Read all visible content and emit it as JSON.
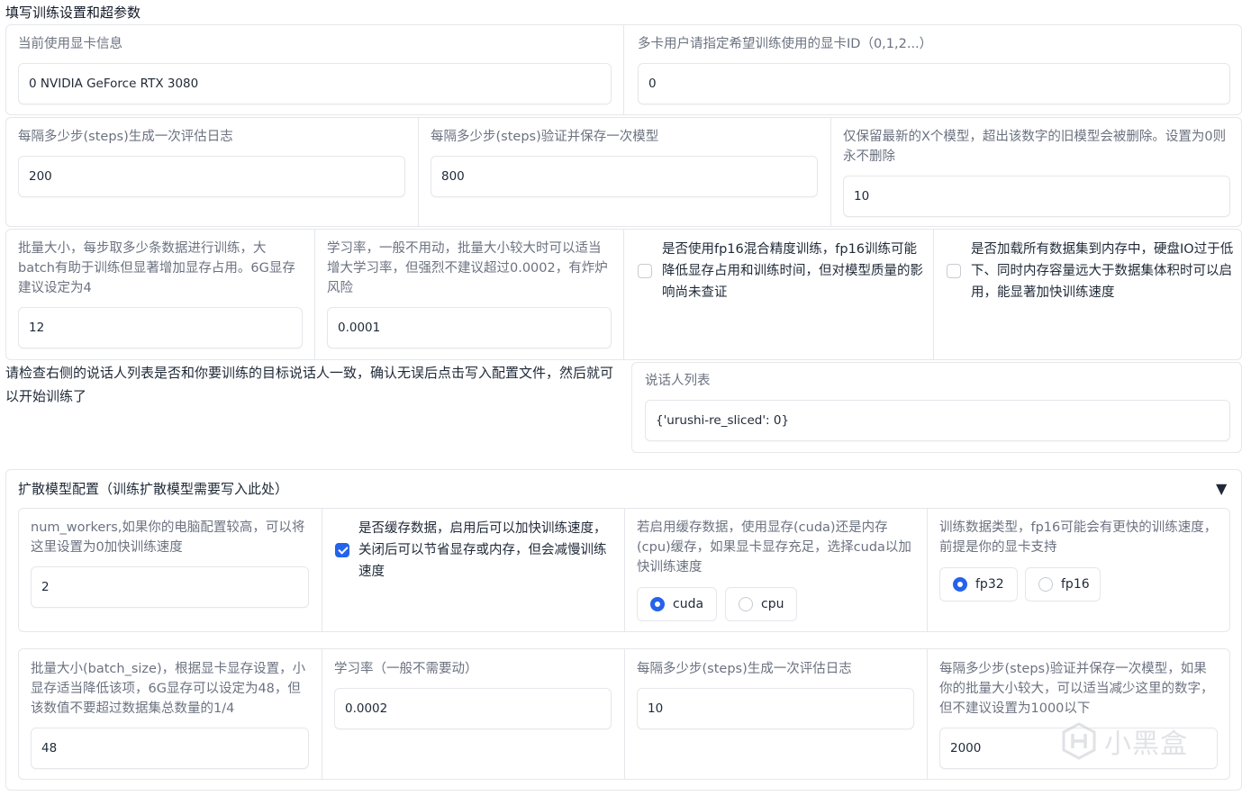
{
  "section_title": "填写训练设置和超参数",
  "gpu": {
    "info_label": "当前使用显卡信息",
    "info_value": "0 NVIDIA GeForce RTX 3080",
    "ids_label": "多卡用户请指定希望训练使用的显卡ID（0,1,2...）",
    "ids_value": "0"
  },
  "logging": {
    "eval_label": "每隔多少步(steps)生成一次评估日志",
    "eval_value": "200",
    "save_label": "每隔多少步(steps)验证并保存一次模型",
    "save_value": "800",
    "keep_label": "仅保留最新的X个模型，超出该数字的旧模型会被删除。设置为0则永不删除",
    "keep_value": "10"
  },
  "train": {
    "batch_label": "批量大小，每步取多少条数据进行训练，大batch有助于训练但显著增加显存占用。6G显存建议设定为4",
    "batch_value": "12",
    "lr_label": "学习率，一般不用动，批量大小较大时可以适当增大学习率，但强烈不建议超过0.0002，有炸炉风险",
    "lr_value": "0.0001",
    "fp16_label": "是否使用fp16混合精度训练，fp16训练可能降低显存占用和训练时间，但对模型质量的影响尚未查证",
    "fp16_checked": false,
    "memload_label": "是否加载所有数据集到内存中，硬盘IO过于低下、同时内存容量远大于数据集体积时可以启用，能显著加快训练速度",
    "memload_checked": false
  },
  "speaker": {
    "instruction": "请检查右侧的说话人列表是否和你要训练的目标说话人一致，确认无误后点击写入配置文件，然后就可以开始训练了",
    "list_label": "说话人列表",
    "list_value": "{'urushi-re_sliced': 0}"
  },
  "diffusion": {
    "title": "扩散模型配置（训练扩散模型需要写入此处）",
    "toggle_icon": "▼",
    "workers_label": "num_workers,如果你的电脑配置较高，可以将这里设置为0加快训练速度",
    "workers_value": "2",
    "cache_label": "是否缓存数据，启用后可以加快训练速度，关闭后可以节省显存或内存，但会减慢训练速度",
    "cache_checked": true,
    "cache_device_label": "若启用缓存数据，使用显存(cuda)还是内存(cpu)缓存，如果显卡显存充足，选择cuda以加快训练速度",
    "cache_device_options": [
      "cuda",
      "cpu"
    ],
    "cache_device_selected": "cuda",
    "dtype_label": "训练数据类型，fp16可能会有更快的训练速度，前提是你的显卡支持",
    "dtype_options": [
      "fp32",
      "fp16"
    ],
    "dtype_selected": "fp32",
    "batch_label": "批量大小(batch_size)，根据显卡显存设置，小显存适当降低该项，6G显存可以设定为48，但该数值不要超过数据集总数量的1/4",
    "batch_value": "48",
    "lr_label": "学习率（一般不需要动）",
    "lr_value": "0.0002",
    "eval_label": "每隔多少步(steps)生成一次评估日志",
    "eval_value": "10",
    "save_label": "每隔多少步(steps)验证并保存一次模型，如果你的批量大小较大，可以适当减少这里的数字，但不建议设置为1000以下",
    "save_value": "2000"
  },
  "watermark": "小黑盒"
}
